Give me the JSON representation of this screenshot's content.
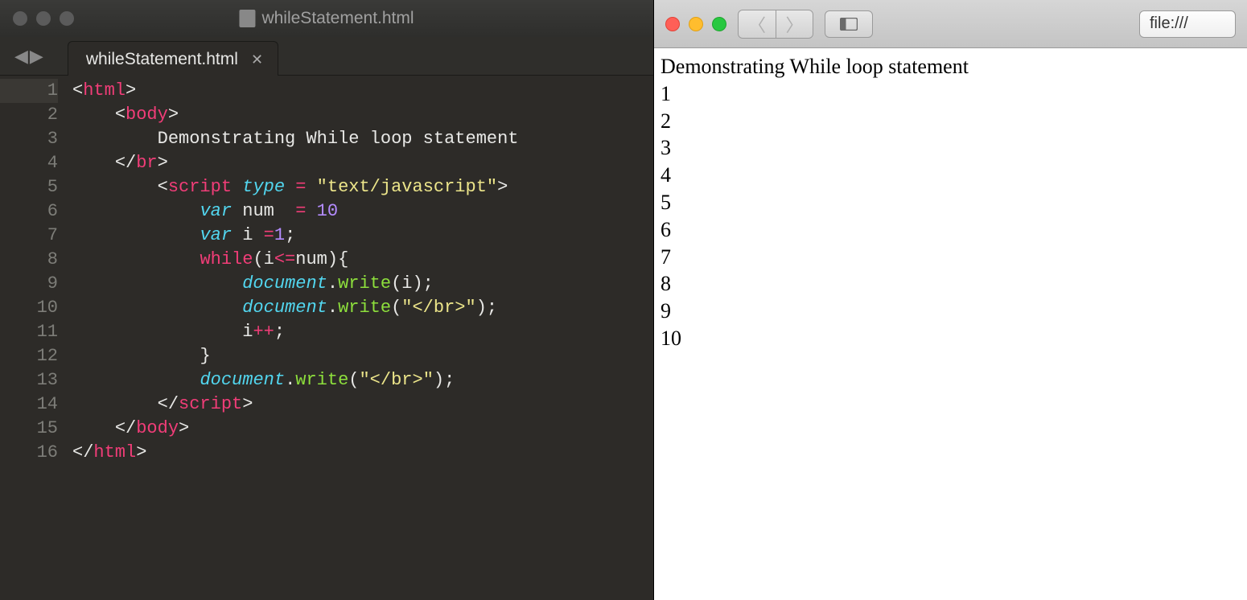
{
  "editor": {
    "window_title": "whileStatement.html",
    "tab": {
      "label": "whileStatement.html"
    },
    "lines": {
      "count": 16,
      "l1_tag": "html",
      "l2_tag": "body",
      "l3_text": "Demonstrating While loop statement",
      "l4_tag": "br",
      "l5_tag": "script",
      "l5_attr": "type",
      "l5_val": "\"text/javascript\"",
      "l6_var": "var",
      "l6_name": "num",
      "l6_eq": "=",
      "l6_val": "10",
      "l7_var": "var",
      "l7_name": "i",
      "l7_eq": "=",
      "l7_val": "1",
      "l8_kw": "while",
      "l8_cond_i": "i",
      "l8_cond_op": "<=",
      "l8_cond_num": "num",
      "l9_obj": "document",
      "l9_fn": "write",
      "l9_arg": "i",
      "l10_obj": "document",
      "l10_fn": "write",
      "l10_arg": "\"</br>\"",
      "l11_i": "i",
      "l11_pp": "++",
      "l13_obj": "document",
      "l13_fn": "write",
      "l13_arg": "\"</br>\"",
      "l14_tag": "script",
      "l15_tag": "body",
      "l16_tag": "html"
    }
  },
  "browser": {
    "address": "file:///",
    "page": {
      "heading": "Demonstrating While loop statement",
      "numbers": [
        "1",
        "2",
        "3",
        "4",
        "5",
        "6",
        "7",
        "8",
        "9",
        "10"
      ]
    }
  }
}
